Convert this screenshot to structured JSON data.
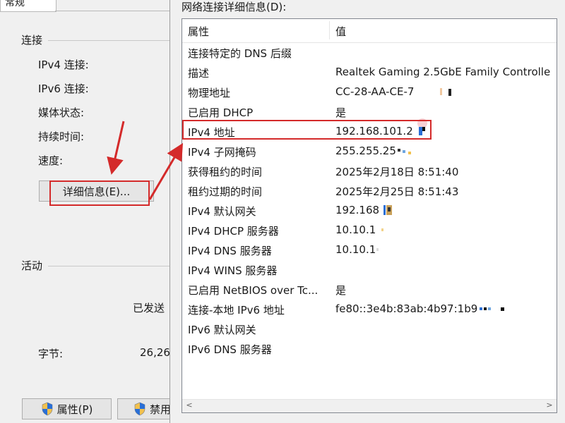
{
  "status_dialog": {
    "tab_label": "常规",
    "connection_section": "连接",
    "rows": [
      "IPv4 连接:",
      "IPv6 连接:",
      "媒体状态:",
      "持续时间:",
      "速度:"
    ],
    "details_button": "详细信息(E)...",
    "activity_section": "活动",
    "sent_label": "已发送",
    "bytes_label": "字节:",
    "bytes_sent": "26,26",
    "properties_button": "属性(P)",
    "disable_button": "禁用"
  },
  "details_dialog": {
    "title": "网络连接详细信息(D):",
    "columns": {
      "property": "属性",
      "value": "值"
    },
    "rows": [
      {
        "property": "连接特定的 DNS 后缀",
        "value": ""
      },
      {
        "property": "描述",
        "value": "Realtek Gaming 2.5GbE Family Controlle"
      },
      {
        "property": "物理地址",
        "value": "CC-28-AA-CE-7"
      },
      {
        "property": "已启用 DHCP",
        "value": "是"
      },
      {
        "property": "IPv4 地址",
        "value": "192.168.101.2"
      },
      {
        "property": "IPv4 子网掩码",
        "value": "255.255.25"
      },
      {
        "property": "获得租约的时间",
        "value": "2025年2月18日 8:51:40"
      },
      {
        "property": "租约过期的时间",
        "value": "2025年2月25日 8:51:43"
      },
      {
        "property": "IPv4 默认网关",
        "value": "192.168"
      },
      {
        "property": "IPv4 DHCP 服务器",
        "value": "10.10.1"
      },
      {
        "property": "IPv4 DNS 服务器",
        "value": "10.10.1"
      },
      {
        "property": "IPv4 WINS 服务器",
        "value": ""
      },
      {
        "property": "已启用 NetBIOS over Tc...",
        "value": "是"
      },
      {
        "property": "连接-本地 IPv6 地址",
        "value": "fe80::3e4b:83ab:4b97:1b9"
      },
      {
        "property": "IPv6 默认网关",
        "value": ""
      },
      {
        "property": "IPv6 DNS 服务器",
        "value": ""
      }
    ],
    "scroll_left": "<",
    "scroll_right": ">"
  },
  "colors": {
    "annotation_red": "#d42a2a",
    "shield_blue": "#2a6fd6",
    "shield_yellow": "#f2c14e"
  },
  "icons": [
    "shield-icon",
    "scroll-left-icon",
    "scroll-right-icon"
  ]
}
